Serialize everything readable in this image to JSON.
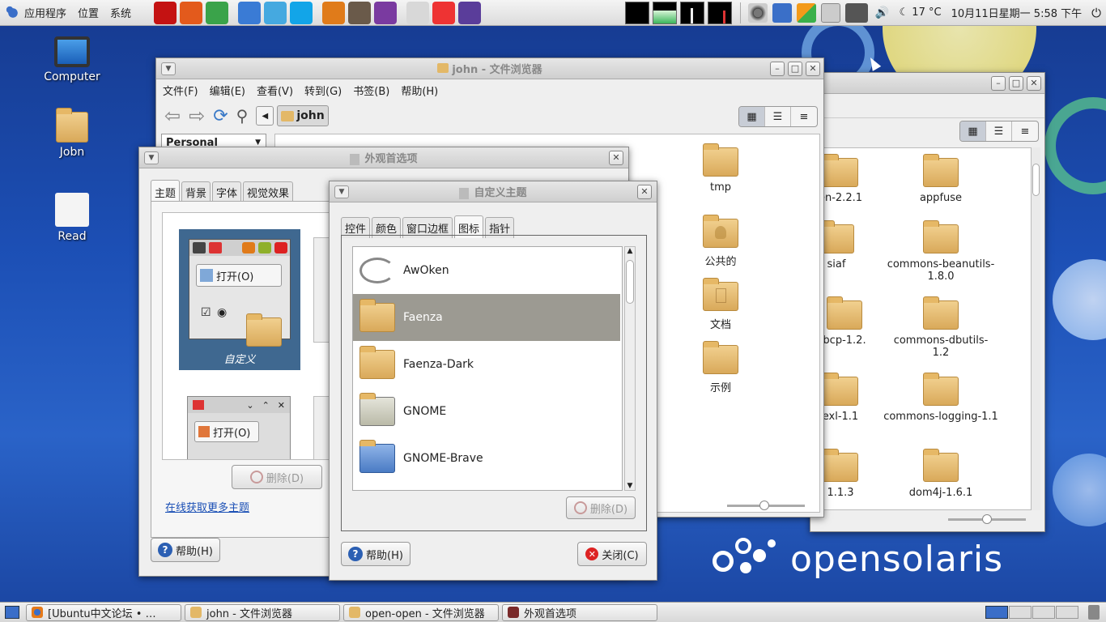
{
  "top_panel": {
    "menus": [
      "应用程序",
      "位置",
      "系统"
    ],
    "launchers": [
      {
        "name": "opera-icon",
        "color": "#c41212"
      },
      {
        "name": "eye-icon",
        "color": "#e35a1c"
      },
      {
        "name": "chrome-icon",
        "color": "#3aa34a"
      },
      {
        "name": "pidgin-icon",
        "color": "#3a7bd5"
      },
      {
        "name": "twitter-icon",
        "color": "#45a9e0"
      },
      {
        "name": "skype-icon",
        "color": "#12a5e8"
      },
      {
        "name": "audio-editor-icon",
        "color": "#e07b1a"
      },
      {
        "name": "speaker-icon",
        "color": "#6a5a4a"
      },
      {
        "name": "headphones-icon",
        "color": "#7a3aa0"
      },
      {
        "name": "checklist-icon",
        "color": "#d8d8d8"
      },
      {
        "name": "gmail-icon",
        "color": "#e33"
      },
      {
        "name": "sphere-icon",
        "color": "#5a3d9a"
      }
    ],
    "weather": "17 °C",
    "date": "10月11日星期一",
    "time": "5:58 下午"
  },
  "desktop": {
    "icons": [
      {
        "label": "Computer",
        "icon": "computer-icon"
      },
      {
        "label": "Jobn",
        "icon": "home-folder-icon"
      },
      {
        "label": "Read",
        "icon": "document-icon"
      }
    ],
    "brand": "opensolaris"
  },
  "file_browser": {
    "title": "john - 文件浏览器",
    "menu": [
      "文件(F)",
      "编辑(E)",
      "查看(V)",
      "转到(G)",
      "书签(B)",
      "帮助(H)"
    ],
    "location": "john",
    "sidebar_label": "Personal",
    "items": [
      "tmp",
      "公共的",
      "文档",
      "示例"
    ]
  },
  "back_browser": {
    "items": [
      "en-2.2.1",
      "appfuse",
      "siaf",
      "commons-beanutils-1.8.0",
      "bcp-1.2.",
      "commons-dbutils-1.2",
      "exl-1.1",
      "commons-logging-1.1",
      "1.1.3",
      "dom4j-1.6.1"
    ]
  },
  "appearance": {
    "title": "外观首选项",
    "tabs": [
      "主题",
      "背景",
      "字体",
      "视觉效果"
    ],
    "preview_open_label": "打开(O)",
    "selected_theme": "自定义",
    "delete_label": "删除(D)",
    "online_link": "在线获取更多主题",
    "help_label": "帮助(H)"
  },
  "custom_theme": {
    "title": "自定义主题",
    "tabs": [
      "控件",
      "颜色",
      "窗口边框",
      "图标",
      "指针"
    ],
    "active_tab": "图标",
    "icon_themes": [
      "AwOken",
      "Faenza",
      "Faenza-Dark",
      "GNOME",
      "GNOME-Brave"
    ],
    "selected": "Faenza",
    "delete_label": "删除(D)",
    "help_label": "帮助(H)",
    "close_label": "关闭(C)"
  },
  "taskbar": {
    "tasks": [
      {
        "label": "[Ubuntu中文论坛 • …",
        "icon": "firefox-icon"
      },
      {
        "label": "john - 文件浏览器",
        "icon": "home-folder-icon"
      },
      {
        "label": "open-open - 文件浏览器",
        "icon": "folder-icon"
      },
      {
        "label": "外观首选项",
        "icon": "appearance-icon"
      }
    ]
  }
}
